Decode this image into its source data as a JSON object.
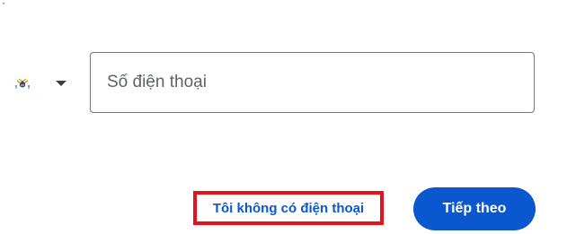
{
  "corner_mark": "·",
  "country": {
    "flag_icon": "flag-us-virgin-islands-icon",
    "dropdown_icon": "caret-down-icon"
  },
  "phone": {
    "placeholder": "Số điện thoại",
    "value": ""
  },
  "actions": {
    "no_phone_label": "Tôi không có điện thoại",
    "next_label": "Tiếp theo"
  },
  "colors": {
    "accent": "#0b57d0",
    "highlight_border": "#e8101b",
    "field_border": "#747775"
  }
}
